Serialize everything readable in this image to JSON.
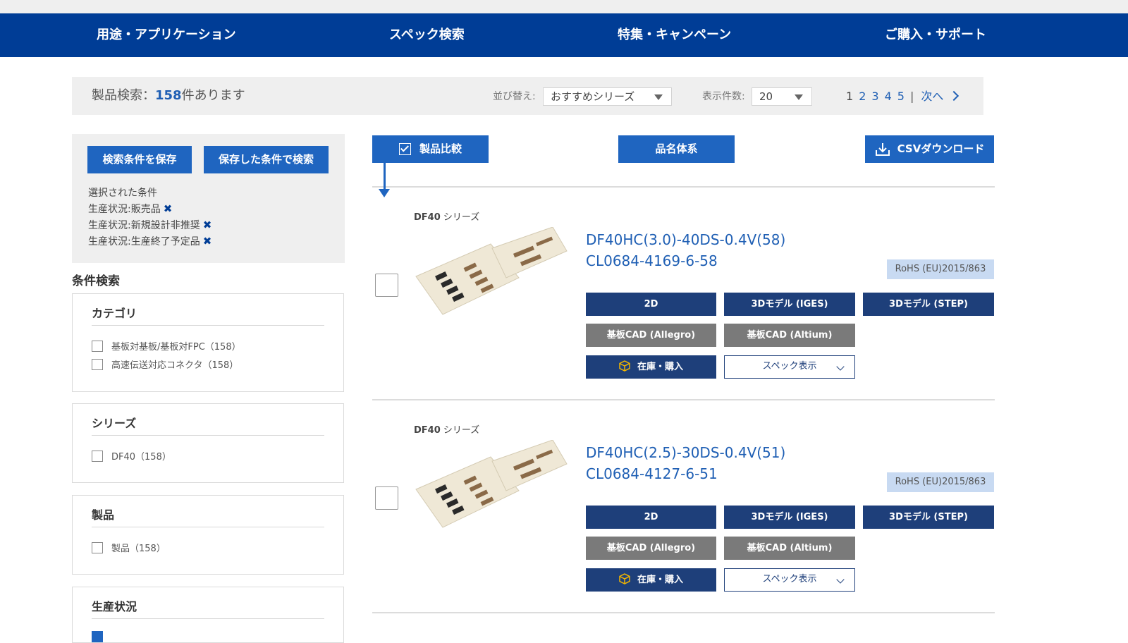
{
  "nav": {
    "items": [
      "用途・アプリケーション",
      "スペック検索",
      "特集・キャンペーン",
      "ご購入・サポート"
    ]
  },
  "results": {
    "prefix": "製品検索：",
    "count": "158",
    "suffix": "件あります",
    "sort_label": "並び替え:",
    "sort_value": "おすすめシリーズ",
    "perpage_label": "表示件数:",
    "perpage_value": "20",
    "pages": [
      "1",
      "2",
      "3",
      "4",
      "5"
    ],
    "current_page": "1",
    "separator": "|",
    "next_label": "次へ"
  },
  "conditions": {
    "save_button": "検索条件を保存",
    "saved_search_button": "保存した条件で検索",
    "selected_label": "選択された条件",
    "selected": [
      "生産状況:販売品",
      "生産状況:新規設計非推奨",
      "生産状況:生産終了予定品"
    ],
    "remove_icon": "✖"
  },
  "filters": {
    "heading": "条件検索",
    "groups": [
      {
        "title": "カテゴリ",
        "options": [
          "基板対基板/基板対FPC（158）",
          "高速伝送対応コネクタ（158）"
        ]
      },
      {
        "title": "シリーズ",
        "options": [
          "DF40（158）"
        ]
      },
      {
        "title": "製品",
        "options": [
          "製品（158）"
        ]
      },
      {
        "title": "生産状況",
        "options": []
      }
    ]
  },
  "toolbar": {
    "compare": "製品比較",
    "naming": "品名体系",
    "csv": "CSVダウンロード"
  },
  "products": [
    {
      "series_code": "DF40",
      "series_suffix": " シリーズ",
      "name": "DF40HC(3.0)-40DS-0.4V(58)",
      "code": "CL0684-4169-6-58",
      "rohs": "RoHS (EU)2015/863",
      "btn_2d": "2D",
      "btn_iges": "3Dモデル (IGES)",
      "btn_step": "3Dモデル (STEP)",
      "btn_allegro": "基板CAD (Allegro)",
      "btn_altium": "基板CAD (Altium)",
      "btn_buy": "在庫・購入",
      "btn_spec": "スペック表示"
    },
    {
      "series_code": "DF40",
      "series_suffix": " シリーズ",
      "name": "DF40HC(2.5)-30DS-0.4V(51)",
      "code": "CL0684-4127-6-51",
      "rohs": "RoHS (EU)2015/863",
      "btn_2d": "2D",
      "btn_iges": "3Dモデル (IGES)",
      "btn_step": "3Dモデル (STEP)",
      "btn_allegro": "基板CAD (Allegro)",
      "btn_altium": "基板CAD (Altium)",
      "btn_buy": "在庫・購入",
      "btn_spec": "スペック表示"
    }
  ],
  "colors": {
    "nav_bg": "#003d96",
    "button_blue": "#1f65c0",
    "button_navy": "#1e3f7a",
    "button_gray": "#7a7a7a",
    "link_blue": "#1f5fb4",
    "rohs_bg": "#c8daf2"
  }
}
